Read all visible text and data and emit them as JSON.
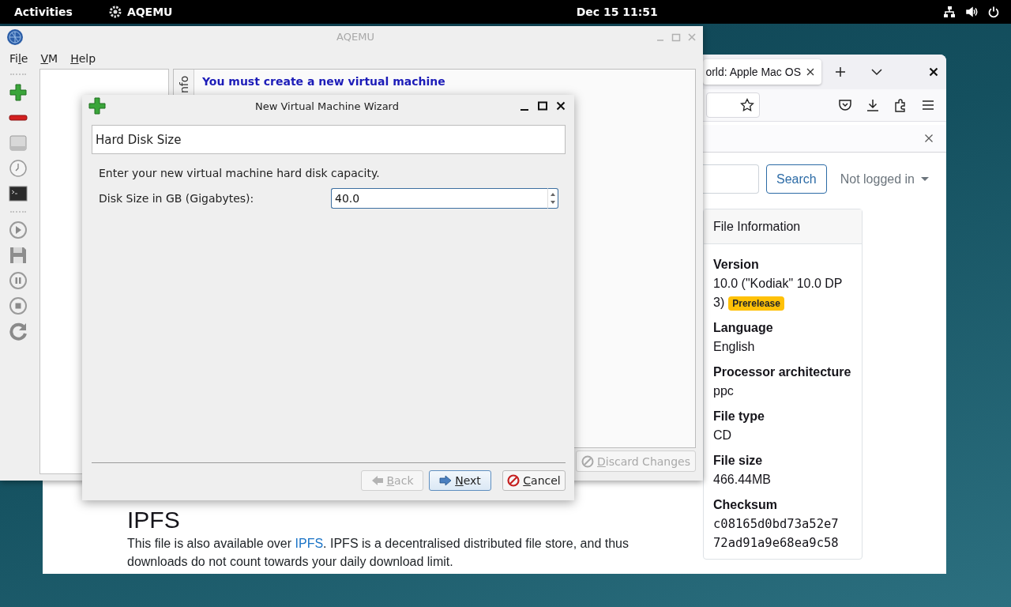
{
  "topbar": {
    "activities": "Activities",
    "app": "AQEMU",
    "clock": "Dec 15  11:51"
  },
  "browser": {
    "tab": {
      "title": "orld: Apple Mac OS",
      "selected": true
    },
    "search_button": "Search",
    "account_menu": "Not logged in",
    "file_info": {
      "title": "File Information",
      "fields": [
        {
          "label": "Version",
          "value": "10.0 (\"Kodiak\" 10.0 DP 3)",
          "badge": "Prerelease",
          "kind": "text"
        },
        {
          "label": "Language",
          "value": "English",
          "kind": "text"
        },
        {
          "label": "Processor architecture",
          "value": "ppc",
          "kind": "text"
        },
        {
          "label": "File type",
          "value": "CD",
          "kind": "text"
        },
        {
          "label": "File size",
          "value": "466.44MB",
          "kind": "text"
        },
        {
          "label": "Checksum",
          "value": "c08165d0bd73a52e772ad91a9e68ea9c58",
          "kind": "code"
        }
      ]
    },
    "ipfs": {
      "heading": "IPFS",
      "text_before": "This file is also available over ",
      "link": "IPFS",
      "text_after": ". IPFS is a decentralised distributed file store, and thus downloads do not count towards your daily download limit."
    }
  },
  "aqemu": {
    "title": "AQEMU",
    "menu": [
      {
        "before": "Fi",
        "key": "l",
        "after": "e"
      },
      {
        "key": "V",
        "after": "M"
      },
      {
        "key": "H",
        "after": "elp"
      }
    ],
    "info_tab": {
      "label": "nfo",
      "selected": true
    },
    "message": "You must create a new virtual machine",
    "discard_button": {
      "key": "D",
      "after": "iscard Changes",
      "disabled": true
    }
  },
  "wizard": {
    "title": "New Virtual Machine Wizard",
    "page_title": "Hard Disk Size",
    "description": "Enter your new virtual machine hard disk capacity.",
    "field": {
      "label": "Disk Size in GB (Gigabytes):",
      "value": "40.0"
    },
    "buttons": [
      {
        "kind": "back",
        "key": "B",
        "after": "ack",
        "disabled": true,
        "default": false
      },
      {
        "kind": "next",
        "key": "N",
        "after": "ext",
        "disabled": false,
        "default": true
      },
      {
        "kind": "cancel",
        "key": "C",
        "after": "ancel",
        "disabled": false,
        "default": false
      }
    ]
  }
}
